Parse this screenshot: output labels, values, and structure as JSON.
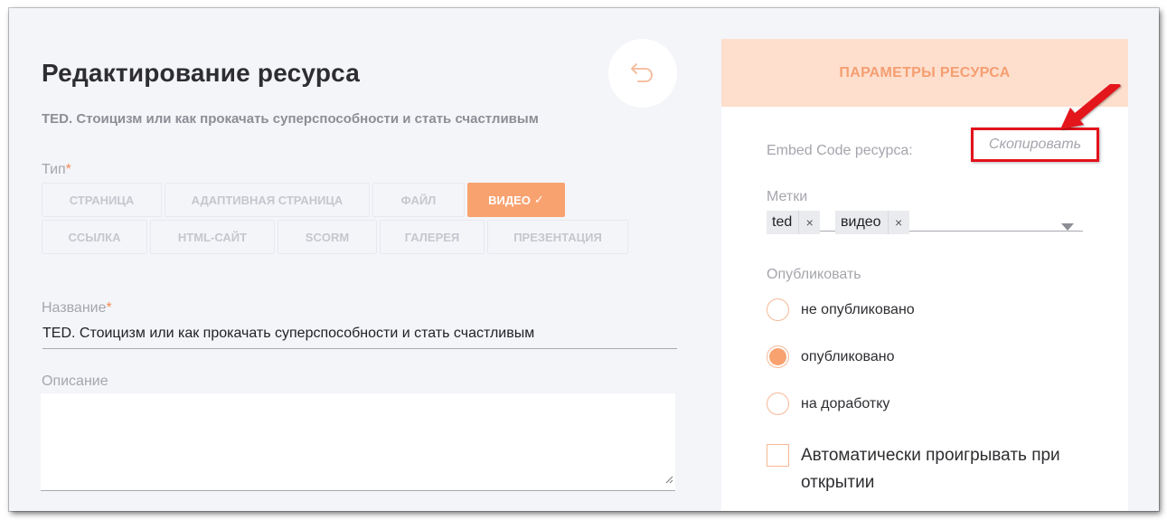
{
  "page": {
    "title": "Редактирование ресурса",
    "subtitle": "TED. Стоицизм или как прокачать суперспособности и стать счастливым",
    "back_icon": "undo-arrow-icon"
  },
  "type_field": {
    "label": "Тип",
    "required_mark": "*",
    "options": [
      "СТРАНИЦА",
      "АДАПТИВНАЯ СТРАНИЦА",
      "ФАЙЛ",
      "ВИДЕО",
      "ССЫЛКА",
      "HTML-САЙТ",
      "SCORM",
      "ГАЛЕРЕЯ",
      "ПРЕЗЕНТАЦИЯ"
    ],
    "selected": "ВИДЕО",
    "selected_check": "✓"
  },
  "name_field": {
    "label": "Название",
    "required_mark": "*",
    "value": "TED. Стоицизм или как прокачать суперспособности и стать счастливым"
  },
  "description_field": {
    "label": "Описание",
    "value": ""
  },
  "panel": {
    "header": "ПАРАМЕТРЫ РЕСУРСА",
    "embed": {
      "label": "Embed Code ресурса:",
      "copy_link": "Скопировать"
    },
    "tags": {
      "label": "Метки",
      "items": [
        "ted",
        "видео"
      ],
      "remove_symbol": "×"
    },
    "publish": {
      "label": "Опубликовать",
      "options": [
        "не опубликовано",
        "опубликовано",
        "на доработку"
      ],
      "selected": "опубликовано"
    },
    "autoplay": {
      "label": "Автоматически проигрывать при открытии",
      "checked": false
    }
  },
  "colors": {
    "accent": "#f8a270",
    "header_bg": "#fedfcd",
    "annotation_red": "#e3121b"
  }
}
